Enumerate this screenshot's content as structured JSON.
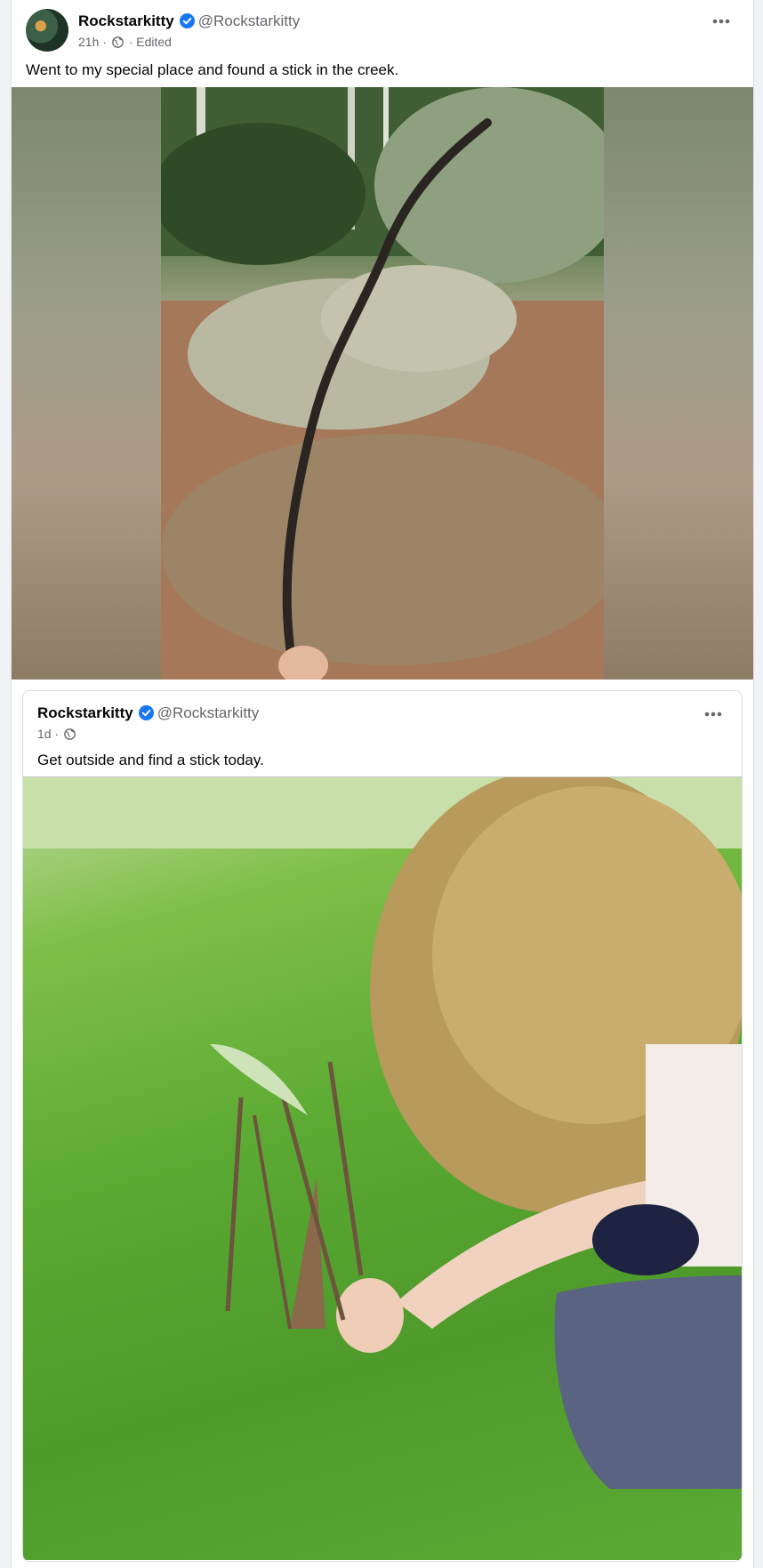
{
  "post": {
    "author_name": "Rockstarkitty",
    "author_handle": "@Rockstarkitty",
    "time": "21h",
    "edited_label": "Edited",
    "caption": "Went to my special place and found a stick in the creek.",
    "verified_color": "#1877f2"
  },
  "shared_post": {
    "author_name": "Rockstarkitty",
    "author_handle": "@Rockstarkitty",
    "time": "1d",
    "caption": "Get outside and find a stick today."
  },
  "icons": {
    "verified": "verified-badge-icon",
    "privacy": "globe-icon",
    "more": "more-options-icon"
  }
}
